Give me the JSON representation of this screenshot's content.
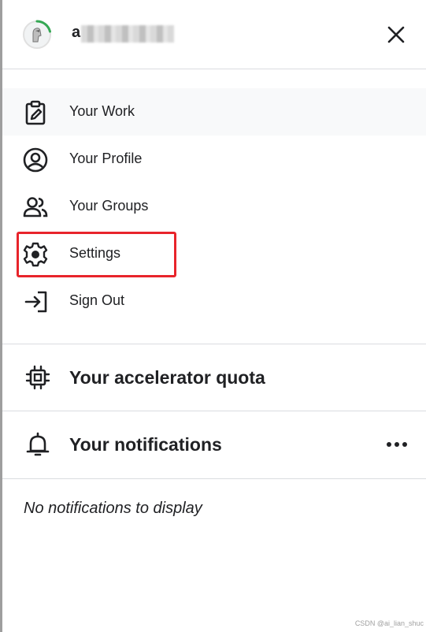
{
  "header": {
    "user_name": "a",
    "close_icon": "close-icon",
    "avatar_ring_color": "#34a853"
  },
  "menu": {
    "items": [
      {
        "label": "Your Work",
        "icon": "clipboard-edit-icon"
      },
      {
        "label": "Your Profile",
        "icon": "user-circle-icon"
      },
      {
        "label": "Your Groups",
        "icon": "users-icon"
      },
      {
        "label": "Settings",
        "icon": "gear-icon"
      },
      {
        "label": "Sign Out",
        "icon": "sign-out-icon"
      }
    ],
    "highlight_color": "#e8242b"
  },
  "quota": {
    "title": "Your accelerator quota",
    "icon": "chip-icon"
  },
  "notifications": {
    "title": "Your notifications",
    "icon": "bell-icon",
    "more_icon": "more-horizontal-icon",
    "empty_text": "No notifications to display"
  },
  "watermark": "CSDN @ai_lian_shuc"
}
